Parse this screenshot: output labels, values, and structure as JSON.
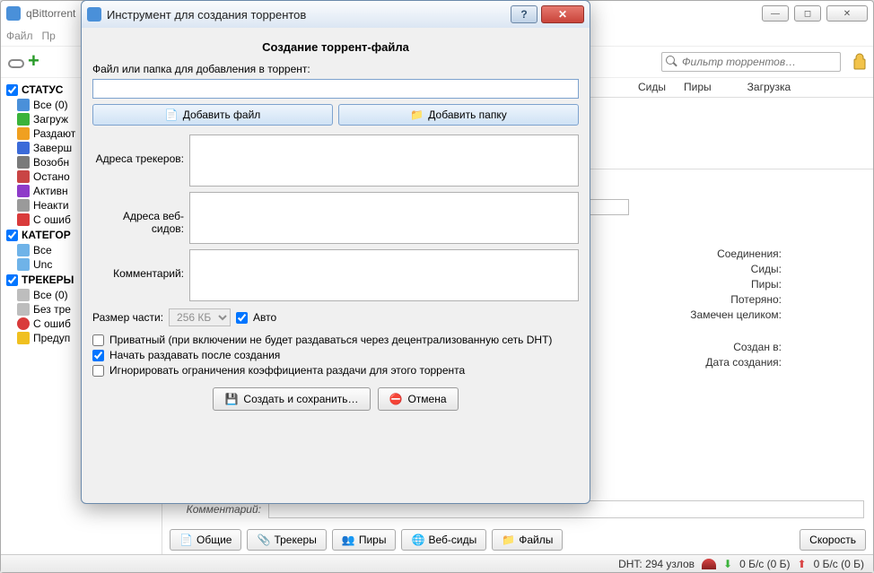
{
  "main": {
    "title": "qBittorrent",
    "menu": {
      "file": "Файл",
      "edit": "Пр"
    },
    "filter_placeholder": "Фильтр торрентов…",
    "columns": {
      "seeds": "Сиды",
      "peers": "Пиры",
      "download": "Загрузка"
    },
    "comment_label": "Комментарий:"
  },
  "sidebar": {
    "status_header": "СТАТУС",
    "status": [
      {
        "label": "Все (0)"
      },
      {
        "label": "Загруж"
      },
      {
        "label": "Раздают"
      },
      {
        "label": "Заверш"
      },
      {
        "label": "Возобн"
      },
      {
        "label": "Остано"
      },
      {
        "label": "Активн"
      },
      {
        "label": "Неакти"
      },
      {
        "label": "С ошиб"
      }
    ],
    "categories_header": "КАТЕГОР",
    "categories": [
      {
        "label": "Все"
      },
      {
        "label": "Unc"
      }
    ],
    "trackers_header": "ТРЕКЕРЫ",
    "trackers": [
      {
        "label": "Все (0)"
      },
      {
        "label": "Без тре"
      },
      {
        "label": "С ошиб"
      },
      {
        "label": "Предуп"
      }
    ]
  },
  "details": {
    "connections": "Соединения:",
    "seeds": "Сиды:",
    "peers": "Пиры:",
    "wasted": "Потеряно:",
    "seen": "Замечен целиком:",
    "created_in": "Создан в:",
    "create_date": "Дата создания:"
  },
  "tabs": {
    "general": "Общие",
    "trackers": "Трекеры",
    "peers": "Пиры",
    "webseeds": "Веб-сиды",
    "files": "Файлы",
    "speed": "Скорость"
  },
  "statusbar": {
    "dht": "DHT: 294 узлов",
    "down": "0 Б/с (0 Б)",
    "up": "0 Б/с (0 Б)"
  },
  "dialog": {
    "title": "Инструмент для создания торрентов",
    "heading": "Создание торрент-файла",
    "path_label": "Файл или папка для добавления в торрент:",
    "add_file": "Добавить файл",
    "add_folder": "Добавить папку",
    "trackers_label": "Адреса трекеров:",
    "webseeds_label": "Адреса веб-сидов:",
    "comment_label": "Комментарий:",
    "piece_label": "Размер части:",
    "piece_value": "256 КБ",
    "auto_label": "Авто",
    "private_label": "Приватный (при включении не будет раздаваться через децентрализованную сеть DHT)",
    "seed_after_label": "Начать раздавать после создания",
    "ignore_ratio_label": "Игнорировать ограничения коэффициента раздачи для этого торрента",
    "create_save": "Создать и сохранить…",
    "cancel": "Отмена"
  }
}
